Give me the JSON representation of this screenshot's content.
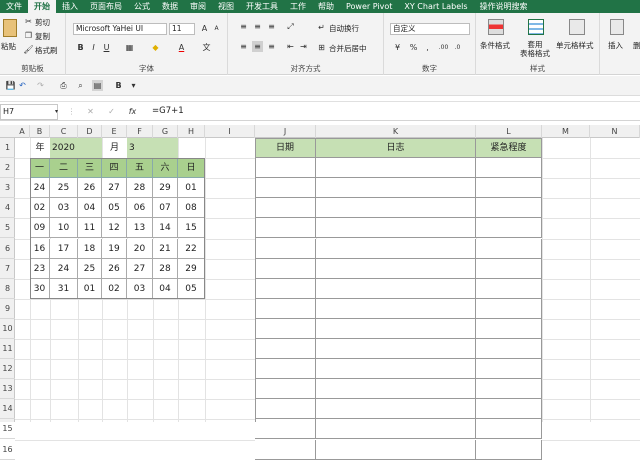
{
  "menu": [
    "文件",
    "开始",
    "插入",
    "页面布局",
    "公式",
    "数据",
    "审阅",
    "视图",
    "开发工具",
    "工作",
    "帮助",
    "Power Pivot",
    "XY Chart Labels",
    "操作说明搜索"
  ],
  "ribbon": {
    "clipboard": {
      "paste": "粘贴",
      "cut": "剪切",
      "copy": "复制",
      "format_painter": "格式刷",
      "label": "剪贴板"
    },
    "font": {
      "name": "Microsoft YaHei UI",
      "size": "11",
      "bold": "B",
      "italic": "I",
      "underline": "U",
      "label": "字体",
      "grow": "A",
      "shrink": "A",
      "color_a": "A",
      "wen": "文"
    },
    "alignment": {
      "wrap": "自动换行",
      "merge": "合并后居中",
      "label": "对齐方式"
    },
    "number": {
      "format": "自定义",
      "label": "数字"
    },
    "styles": {
      "conditional": "条件格式",
      "table": "套用\n表格格式",
      "cell": "单元格样式",
      "label": "样式"
    },
    "cells": {
      "insert": "插入",
      "delete": "删"
    }
  },
  "formula_bar": {
    "name": "H7",
    "fx": "fx",
    "formula": "=G7+1"
  },
  "columns": [
    "A",
    "B",
    "C",
    "D",
    "E",
    "F",
    "G",
    "H",
    "I",
    "J",
    "K",
    "L",
    "M",
    "N"
  ],
  "rows": [
    "1",
    "2",
    "3",
    "4",
    "5",
    "6",
    "7",
    "8",
    "9",
    "10",
    "11",
    "12",
    "13",
    "14",
    "15",
    "16"
  ],
  "calendar": {
    "year_label": "年",
    "year": "2020",
    "month_label": "月",
    "month": "3",
    "weekdays": [
      "一",
      "二",
      "三",
      "四",
      "五",
      "六",
      "日"
    ],
    "weeks": [
      [
        "24",
        "25",
        "26",
        "27",
        "28",
        "29",
        "01"
      ],
      [
        "02",
        "03",
        "04",
        "05",
        "06",
        "07",
        "08"
      ],
      [
        "09",
        "10",
        "11",
        "12",
        "13",
        "14",
        "15"
      ],
      [
        "16",
        "17",
        "18",
        "19",
        "20",
        "21",
        "22"
      ],
      [
        "23",
        "24",
        "25",
        "26",
        "27",
        "28",
        "29"
      ],
      [
        "30",
        "31",
        "01",
        "02",
        "03",
        "04",
        "05"
      ]
    ]
  },
  "log_table": {
    "date": "日期",
    "log": "日志",
    "urgency": "紧急程度"
  },
  "colors": {
    "excel_green": "#217346",
    "calendar_fill": "#c6e0b4",
    "weekday_fill": "#a9d08e",
    "log_header": "#c6e0b4"
  }
}
